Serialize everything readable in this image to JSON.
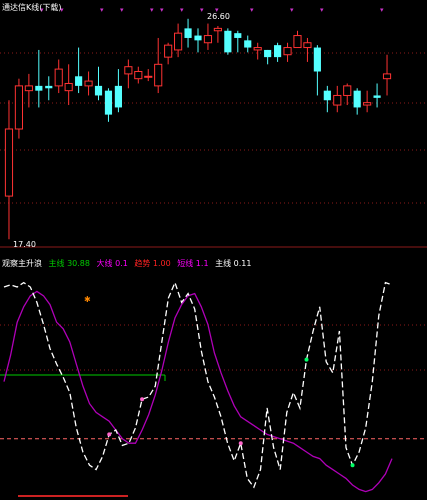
{
  "top_panel": {
    "title": "通达信K线(下载)",
    "high_label": "26.60",
    "low_label": "17.40",
    "candles": [
      {
        "o": 19.2,
        "c": 22.0,
        "h": 23.2,
        "l": 17.4
      },
      {
        "o": 22.0,
        "c": 23.8,
        "h": 24.1,
        "l": 21.6
      },
      {
        "o": 23.6,
        "c": 23.8,
        "h": 24.3,
        "l": 22.9
      },
      {
        "o": 23.8,
        "c": 23.6,
        "h": 25.3,
        "l": 22.9
      },
      {
        "o": 23.8,
        "c": 23.7,
        "h": 24.2,
        "l": 23.2
      },
      {
        "o": 23.8,
        "c": 24.5,
        "h": 24.9,
        "l": 23.5
      },
      {
        "o": 23.6,
        "c": 23.9,
        "h": 24.7,
        "l": 23.0
      },
      {
        "o": 24.2,
        "c": 23.8,
        "h": 25.4,
        "l": 23.5
      },
      {
        "o": 23.8,
        "c": 24.0,
        "h": 24.4,
        "l": 23.4
      },
      {
        "o": 23.8,
        "c": 23.4,
        "h": 24.6,
        "l": 23.2
      },
      {
        "o": 23.6,
        "c": 22.6,
        "h": 23.7,
        "l": 22.3
      },
      {
        "o": 23.8,
        "c": 22.9,
        "h": 24.5,
        "l": 22.7
      },
      {
        "o": 24.3,
        "c": 24.6,
        "h": 24.9,
        "l": 23.7
      },
      {
        "o": 24.1,
        "c": 24.4,
        "h": 24.6,
        "l": 23.9
      },
      {
        "o": 24.2,
        "c": 24.2,
        "h": 24.5,
        "l": 24.0
      },
      {
        "o": 23.8,
        "c": 24.7,
        "h": 25.8,
        "l": 23.5
      },
      {
        "o": 25.0,
        "c": 25.5,
        "h": 25.6,
        "l": 24.7
      },
      {
        "o": 25.3,
        "c": 26.0,
        "h": 26.4,
        "l": 25.0
      },
      {
        "o": 26.2,
        "c": 25.8,
        "h": 26.6,
        "l": 25.4
      },
      {
        "o": 25.9,
        "c": 25.7,
        "h": 26.2,
        "l": 25.2
      },
      {
        "o": 25.6,
        "c": 25.9,
        "h": 26.4,
        "l": 25.3
      },
      {
        "o": 26.1,
        "c": 26.2,
        "h": 26.3,
        "l": 25.6
      },
      {
        "o": 26.1,
        "c": 25.2,
        "h": 26.2,
        "l": 25.1
      },
      {
        "o": 26.0,
        "c": 25.8,
        "h": 26.1,
        "l": 25.2
      },
      {
        "o": 25.7,
        "c": 25.4,
        "h": 25.9,
        "l": 25.2
      },
      {
        "o": 25.3,
        "c": 25.4,
        "h": 25.6,
        "l": 24.9
      },
      {
        "o": 25.3,
        "c": 25.0,
        "h": 25.3,
        "l": 24.7
      },
      {
        "o": 25.5,
        "c": 25.0,
        "h": 25.6,
        "l": 24.8
      },
      {
        "o": 25.1,
        "c": 25.4,
        "h": 25.6,
        "l": 24.8
      },
      {
        "o": 25.4,
        "c": 25.9,
        "h": 26.1,
        "l": 25.4
      },
      {
        "o": 25.4,
        "c": 25.6,
        "h": 25.8,
        "l": 24.8
      },
      {
        "o": 25.4,
        "c": 24.4,
        "h": 25.5,
        "l": 23.4
      },
      {
        "o": 23.6,
        "c": 23.2,
        "h": 23.8,
        "l": 22.7
      },
      {
        "o": 23.0,
        "c": 23.4,
        "h": 23.8,
        "l": 22.7
      },
      {
        "o": 23.4,
        "c": 23.8,
        "h": 23.9,
        "l": 23.0
      },
      {
        "o": 23.6,
        "c": 22.9,
        "h": 23.7,
        "l": 22.6
      },
      {
        "o": 23.0,
        "c": 23.1,
        "h": 23.6,
        "l": 22.7
      },
      {
        "o": 23.4,
        "c": 23.3,
        "h": 23.9,
        "l": 22.9
      },
      {
        "o": 24.1,
        "c": 24.3,
        "h": 25.1,
        "l": 23.4
      }
    ]
  },
  "bottom_panel": {
    "legend": [
      {
        "text": "观察主升浪",
        "color": "#ffffff"
      },
      {
        "text": "主线 30.88",
        "color": "#00cc00"
      },
      {
        "text": "大线 0.1",
        "color": "#ff00ff"
      },
      {
        "text": "趋势 1.00",
        "color": "#ff2222"
      },
      {
        "text": "短线 1.1",
        "color": "#ff00ff"
      },
      {
        "text": "主线 0.11",
        "color": "#ffffff"
      }
    ],
    "white_line": [
      95,
      96,
      95,
      97,
      95,
      88,
      78,
      67,
      60,
      54,
      47,
      31,
      20,
      14,
      12,
      18,
      28,
      30,
      23,
      24,
      31,
      44,
      45,
      50,
      70,
      90,
      97,
      88,
      92,
      85,
      66,
      52,
      45,
      36,
      24,
      16,
      24,
      8,
      4,
      12,
      40,
      22,
      12,
      38,
      47,
      40,
      62,
      75,
      86,
      61,
      56,
      75,
      22,
      14,
      20,
      31,
      52,
      82,
      97,
      96
    ],
    "purple_line": [
      52,
      64,
      79,
      86,
      91,
      93,
      91,
      87,
      79,
      76,
      70,
      60,
      50,
      42,
      38,
      36,
      34,
      30,
      26,
      24,
      24,
      30,
      37,
      46,
      57,
      70,
      81,
      87,
      91,
      92,
      86,
      78,
      65,
      56,
      48,
      41,
      36,
      34,
      32,
      30,
      28,
      27,
      26,
      25,
      24,
      22,
      20,
      18,
      17,
      14,
      12,
      10,
      8,
      5,
      3,
      2,
      3,
      6,
      10,
      17
    ],
    "green_level": 55,
    "dashed_level": 26,
    "markers": [
      {
        "i": 16,
        "color": "#ff66cc"
      },
      {
        "i": 21,
        "color": "#ff66cc"
      },
      {
        "i": 36,
        "color": "#ff66cc"
      },
      {
        "i": 46,
        "color": "#00ff66"
      },
      {
        "i": 53,
        "color": "#00ff66"
      }
    ]
  }
}
